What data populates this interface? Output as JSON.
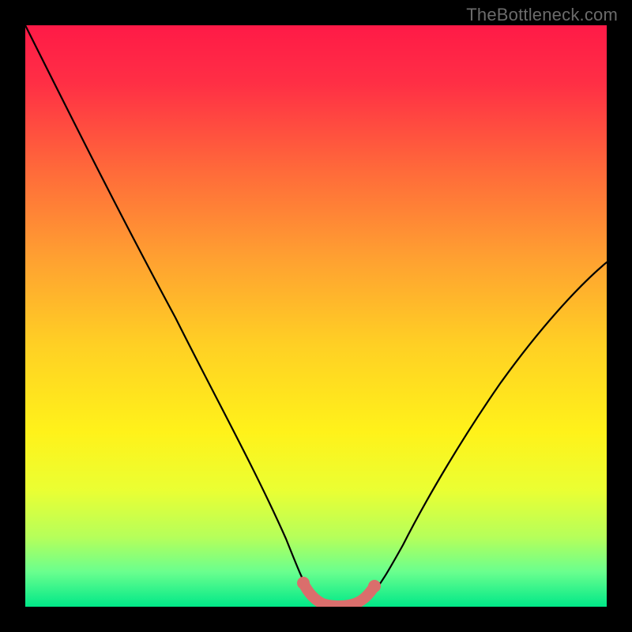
{
  "watermark": "TheBottleneck.com",
  "chart_data": {
    "type": "line",
    "title": "",
    "xlabel": "",
    "ylabel": "",
    "xlim": [
      0,
      100
    ],
    "ylim": [
      0,
      100
    ],
    "grid": false,
    "legend": false,
    "annotations": [],
    "background": {
      "type": "vertical-gradient",
      "stops": [
        {
          "pos": 0.0,
          "color": "#ff1a47"
        },
        {
          "pos": 0.1,
          "color": "#ff2f45"
        },
        {
          "pos": 0.25,
          "color": "#ff6a3a"
        },
        {
          "pos": 0.4,
          "color": "#ffa031"
        },
        {
          "pos": 0.55,
          "color": "#ffd024"
        },
        {
          "pos": 0.7,
          "color": "#fff21a"
        },
        {
          "pos": 0.8,
          "color": "#eaff33"
        },
        {
          "pos": 0.88,
          "color": "#b6ff5a"
        },
        {
          "pos": 0.94,
          "color": "#6aff8e"
        },
        {
          "pos": 1.0,
          "color": "#00e888"
        }
      ]
    },
    "series": [
      {
        "name": "bottleneck-curve",
        "color": "#000000",
        "x": [
          0,
          5,
          10,
          15,
          20,
          25,
          30,
          35,
          40,
          45,
          48,
          50,
          52,
          54,
          56,
          58,
          60,
          65,
          70,
          75,
          80,
          85,
          90,
          95,
          100
        ],
        "y": [
          100,
          91,
          82,
          73,
          64,
          55,
          46,
          37,
          27,
          14,
          4,
          1,
          0,
          0,
          0,
          1,
          4,
          13,
          23,
          32,
          41,
          49,
          56,
          61,
          64
        ]
      },
      {
        "name": "optimal-zone-highlight",
        "color": "#da6e6c",
        "style": "thick-rounded",
        "x": [
          48,
          50,
          52,
          54,
          56,
          58,
          60
        ],
        "y": [
          4,
          1,
          0,
          0,
          0,
          1,
          4
        ]
      }
    ]
  }
}
